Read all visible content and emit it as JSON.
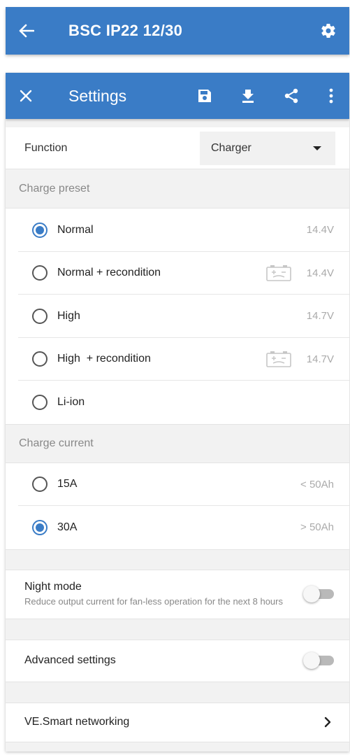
{
  "device_bar": {
    "title": "BSC IP22 12/30",
    "back_icon": "arrow-left-icon",
    "settings_icon": "gear-icon"
  },
  "settings_bar": {
    "title": "Settings",
    "close_icon": "close-icon",
    "actions": [
      "save-icon",
      "download-icon",
      "share-icon",
      "more-vert-icon"
    ]
  },
  "function": {
    "label": "Function",
    "value": "Charger"
  },
  "charge_preset": {
    "heading": "Charge preset",
    "options": [
      {
        "label": "Normal",
        "value": "14.4V",
        "selected": true,
        "recondition_icon": false
      },
      {
        "label": "Normal + recondition",
        "value": "14.4V",
        "selected": false,
        "recondition_icon": true
      },
      {
        "label": "High",
        "value": "14.7V",
        "selected": false,
        "recondition_icon": false
      },
      {
        "label": "High  + recondition",
        "value": "14.7V",
        "selected": false,
        "recondition_icon": true
      },
      {
        "label": "Li-ion",
        "value": "",
        "selected": false,
        "recondition_icon": false
      }
    ]
  },
  "charge_current": {
    "heading": "Charge current",
    "options": [
      {
        "label": "15A",
        "value": "< 50Ah",
        "selected": false
      },
      {
        "label": "30A",
        "value": "> 50Ah",
        "selected": true
      }
    ]
  },
  "night_mode": {
    "label": "Night mode",
    "description": "Reduce output current for fan-less operation for the next 8 hours",
    "enabled": false
  },
  "advanced_settings": {
    "label": "Advanced settings",
    "enabled": false
  },
  "networking": {
    "label": "VE.Smart networking",
    "icon": "chevron-right-icon"
  },
  "colors": {
    "primary": "#3a7cc6",
    "background": "#f2f2f2"
  }
}
